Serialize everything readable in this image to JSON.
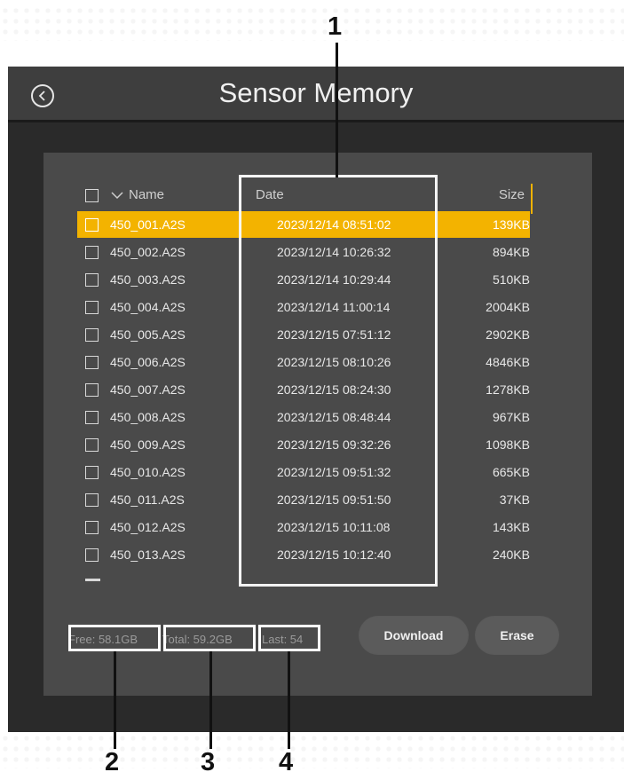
{
  "app": {
    "title": "Sensor Memory"
  },
  "table": {
    "headers": {
      "name": "Name",
      "date": "Date",
      "size": "Size"
    },
    "rows": [
      {
        "name": "450_001.A2S",
        "date": "2023/12/14 08:51:02",
        "size": "139KB",
        "selected": true
      },
      {
        "name": "450_002.A2S",
        "date": "2023/12/14 10:26:32",
        "size": "894KB"
      },
      {
        "name": "450_003.A2S",
        "date": "2023/12/14 10:29:44",
        "size": "510KB"
      },
      {
        "name": "450_004.A2S",
        "date": "2023/12/14 11:00:14",
        "size": "2004KB"
      },
      {
        "name": "450_005.A2S",
        "date": "2023/12/15 07:51:12",
        "size": "2902KB"
      },
      {
        "name": "450_006.A2S",
        "date": "2023/12/15 08:10:26",
        "size": "4846KB"
      },
      {
        "name": "450_007.A2S",
        "date": "2023/12/15 08:24:30",
        "size": "1278KB"
      },
      {
        "name": "450_008.A2S",
        "date": "2023/12/15 08:48:44",
        "size": "967KB"
      },
      {
        "name": "450_009.A2S",
        "date": "2023/12/15 09:32:26",
        "size": "1098KB"
      },
      {
        "name": "450_010.A2S",
        "date": "2023/12/15 09:51:32",
        "size": "665KB"
      },
      {
        "name": "450_011.A2S",
        "date": "2023/12/15 09:51:50",
        "size": "37KB"
      },
      {
        "name": "450_012.A2S",
        "date": "2023/12/15 10:11:08",
        "size": "143KB"
      },
      {
        "name": "450_013.A2S",
        "date": "2023/12/15 10:12:40",
        "size": "240KB"
      }
    ]
  },
  "status": {
    "free": "Free: 58.1GB",
    "total": "Total: 59.2GB",
    "last": "Last: 54"
  },
  "buttons": {
    "download": "Download",
    "erase": "Erase"
  },
  "callouts": {
    "c1": "1",
    "c2": "2",
    "c3": "3",
    "c4": "4"
  },
  "colors": {
    "accent": "#f3b300",
    "panel": "#4a4a4a",
    "background": "#2a2a2a"
  },
  "icons": {
    "back": "back-arrow-circle-icon",
    "sort": "chevron-down-icon"
  }
}
